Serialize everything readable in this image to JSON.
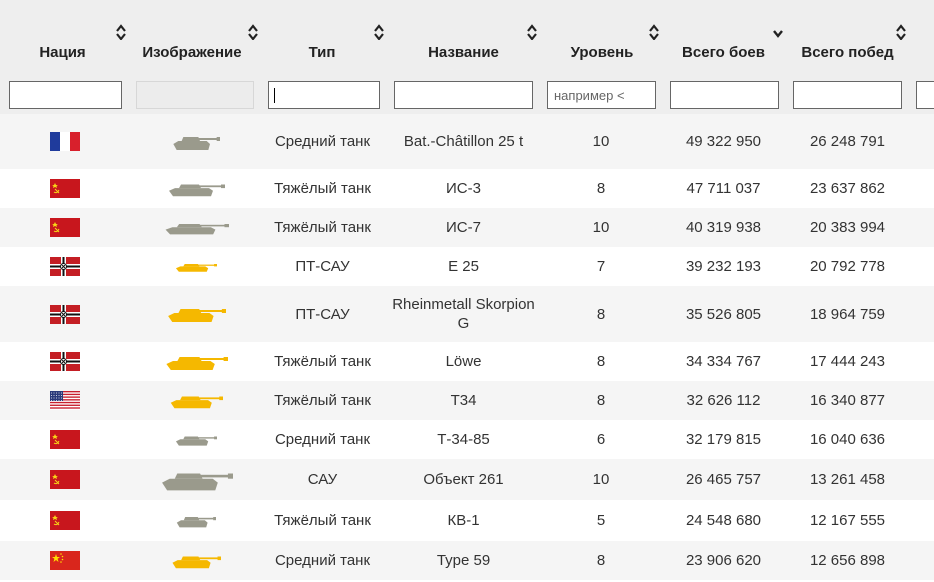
{
  "columns": {
    "nation": "Нация",
    "image": "Изображение",
    "type": "Тип",
    "name": "Название",
    "tier": "Уровень",
    "battles": "Всего боев",
    "wins": "Всего побед"
  },
  "filters": {
    "tier_placeholder": "например <"
  },
  "colors": {
    "header_bg": "#eeeeee",
    "row_alt_bg": "#f5f5f5",
    "tank_gray": "#9a9a8c",
    "tank_yellow": "#f5b800",
    "edge_green": "#8dc63f"
  },
  "rows": [
    {
      "nation": "france",
      "tank_color": "gray",
      "type": "Средний танк",
      "name": "Bat.-Châtillon 25 t",
      "tier": "10",
      "battles": "49 322 950",
      "wins": "26 248 791"
    },
    {
      "nation": "ussr",
      "tank_color": "gray",
      "type": "Тяжёлый танк",
      "name": "ИС-3",
      "tier": "8",
      "battles": "47 711 037",
      "wins": "23 637 862"
    },
    {
      "nation": "ussr",
      "tank_color": "gray",
      "type": "Тяжёлый танк",
      "name": "ИС-7",
      "tier": "10",
      "battles": "40 319 938",
      "wins": "20 383 994"
    },
    {
      "nation": "germany",
      "tank_color": "yellow",
      "type": "ПТ-САУ",
      "name": "E 25",
      "tier": "7",
      "battles": "39 232 193",
      "wins": "20 792 778"
    },
    {
      "nation": "germany",
      "tank_color": "yellow",
      "type": "ПТ-САУ",
      "name": "Rheinmetall Skorpion G",
      "tier": "8",
      "battles": "35 526 805",
      "wins": "18 964 759"
    },
    {
      "nation": "germany",
      "tank_color": "yellow",
      "type": "Тяжёлый танк",
      "name": "Löwe",
      "tier": "8",
      "battles": "34 334 767",
      "wins": "17 444 243"
    },
    {
      "nation": "usa",
      "tank_color": "yellow",
      "type": "Тяжёлый танк",
      "name": "T34",
      "tier": "8",
      "battles": "32 626 112",
      "wins": "16 340 877"
    },
    {
      "nation": "ussr",
      "tank_color": "gray",
      "type": "Средний танк",
      "name": "Т-34-85",
      "tier": "6",
      "battles": "32 179 815",
      "wins": "16 040 636"
    },
    {
      "nation": "ussr",
      "tank_color": "gray",
      "type": "САУ",
      "name": "Объект 261",
      "tier": "10",
      "battles": "26 465 757",
      "wins": "13 261 458"
    },
    {
      "nation": "ussr",
      "tank_color": "gray",
      "type": "Тяжёлый танк",
      "name": "КВ-1",
      "tier": "5",
      "battles": "24 548 680",
      "wins": "12 167 555"
    },
    {
      "nation": "china",
      "tank_color": "yellow",
      "type": "Средний танк",
      "name": "Type 59",
      "tier": "8",
      "battles": "23 906 620",
      "wins": "12 656 898"
    }
  ]
}
